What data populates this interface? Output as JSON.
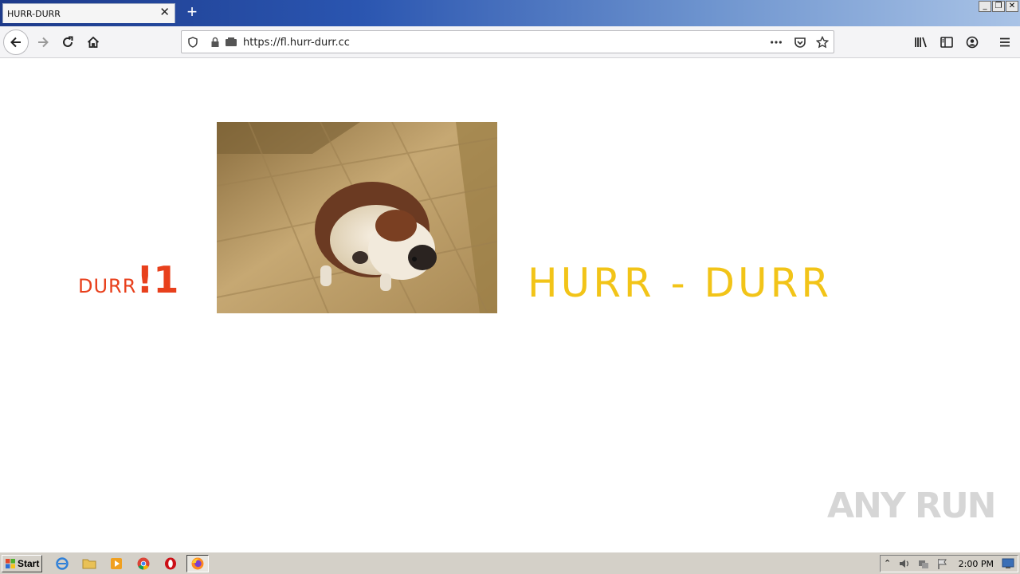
{
  "browser": {
    "tab_title": "HURR-DURR",
    "tab_close": "✕",
    "new_tab": "+",
    "url": "https://fl.hurr-durr.cc",
    "window_controls": {
      "minimize": "_",
      "restore": "❐",
      "close": "✕"
    }
  },
  "page": {
    "durr_small": "DURR",
    "durr_big": "!1",
    "hurr_title": "HURR - DURR",
    "durr_color": "#e8401c",
    "hurr_color": "#f2c418",
    "photo_subject": "bulldog photo"
  },
  "watermark": {
    "text": "ANY RUN"
  },
  "taskbar": {
    "start_label": "Start",
    "apps": [
      "ie-icon",
      "folder-icon",
      "media-player-icon",
      "chrome-icon",
      "opera-icon",
      "firefox-icon"
    ],
    "clock": "2:00 PM"
  }
}
